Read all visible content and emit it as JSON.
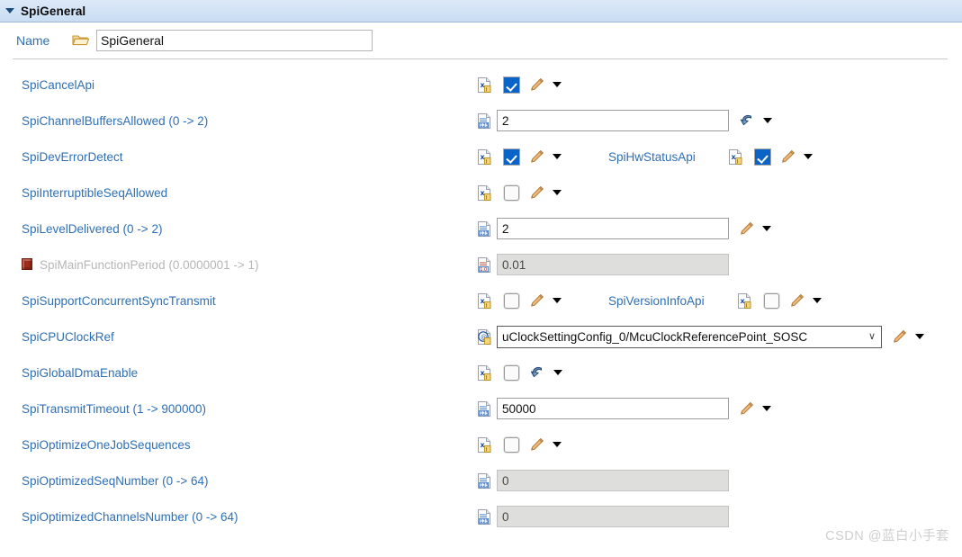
{
  "section": {
    "title": "SpiGeneral",
    "twisty_icon": "chevron-down-icon"
  },
  "name_row": {
    "label": "Name",
    "folder_icon": "folder-open-icon",
    "value": "SpiGeneral",
    "placeholder": ""
  },
  "rows": [
    {
      "label": "SpiCancelApi",
      "control": "checkbox",
      "checked": true,
      "value": "",
      "lead_icon": "x-document-icon",
      "trail_icon": "pencil-icon",
      "caret": true,
      "disabled": false,
      "error": false,
      "second": null
    },
    {
      "label": "SpiChannelBuffersAllowed (0 -> 2)",
      "control": "text",
      "checked": false,
      "value": "2",
      "lead_icon": "number-document-icon",
      "trail_icon": "swirl-arrow-icon",
      "caret": true,
      "disabled": false,
      "error": false,
      "second": null
    },
    {
      "label": "SpiDevErrorDetect",
      "control": "checkbox",
      "checked": true,
      "value": "",
      "lead_icon": "x-document-icon",
      "trail_icon": "pencil-icon",
      "caret": true,
      "disabled": false,
      "error": false,
      "second": {
        "label": "SpiHwStatusApi",
        "control": "checkbox",
        "checked": true,
        "lead_icon": "x-document-icon",
        "trail_icon": "pencil-icon",
        "caret": true
      }
    },
    {
      "label": "SpiInterruptibleSeqAllowed",
      "control": "checkbox",
      "checked": false,
      "value": "",
      "lead_icon": "x-document-icon",
      "trail_icon": "pencil-icon",
      "caret": true,
      "disabled": false,
      "error": false,
      "second": null
    },
    {
      "label": "SpiLevelDelivered (0 -> 2)",
      "control": "text",
      "checked": false,
      "value": "2",
      "lead_icon": "number-document-icon",
      "trail_icon": "pencil-icon",
      "caret": true,
      "disabled": false,
      "error": false,
      "second": null
    },
    {
      "label": "SpiMainFunctionPeriod (0.0000001 -> 1)",
      "control": "text-readonly",
      "checked": false,
      "value": "0.01",
      "lead_icon": "float-document-icon",
      "trail_icon": "none",
      "caret": false,
      "disabled": true,
      "error": true,
      "second": null
    },
    {
      "label": "SpiSupportConcurrentSyncTransmit",
      "control": "checkbox",
      "checked": false,
      "value": "",
      "lead_icon": "x-document-icon",
      "trail_icon": "pencil-icon",
      "caret": true,
      "disabled": false,
      "error": false,
      "second": {
        "label": "SpiVersionInfoApi",
        "control": "checkbox",
        "checked": false,
        "lead_icon": "x-document-icon",
        "trail_icon": "pencil-icon",
        "caret": true
      }
    },
    {
      "label": "SpiCPUClockRef",
      "control": "combo",
      "checked": false,
      "value": "uClockSettingConfig_0/McuClockReferencePoint_SOSC",
      "lead_icon": "at-document-icon",
      "trail_icon": "pencil-icon",
      "caret": true,
      "disabled": false,
      "error": false,
      "second": null
    },
    {
      "label": "SpiGlobalDmaEnable",
      "control": "checkbox",
      "checked": false,
      "value": "",
      "lead_icon": "x-document-icon",
      "trail_icon": "swirl-arrow-icon",
      "caret": true,
      "disabled": false,
      "error": false,
      "second": null
    },
    {
      "label": "SpiTransmitTimeout (1 -> 900000)",
      "control": "text",
      "checked": false,
      "value": "50000",
      "lead_icon": "number-document-icon",
      "trail_icon": "pencil-icon",
      "caret": true,
      "disabled": false,
      "error": false,
      "second": null
    },
    {
      "label": "SpiOptimizeOneJobSequences",
      "control": "checkbox",
      "checked": false,
      "value": "",
      "lead_icon": "x-document-icon",
      "trail_icon": "pencil-icon",
      "caret": true,
      "disabled": false,
      "error": false,
      "second": null
    },
    {
      "label": "SpiOptimizedSeqNumber (0 -> 64)",
      "control": "text-readonly",
      "checked": false,
      "value": "0",
      "lead_icon": "number-document-icon",
      "trail_icon": "none",
      "caret": false,
      "disabled": false,
      "error": false,
      "second": null
    },
    {
      "label": "SpiOptimizedChannelsNumber (0 -> 64)",
      "control": "text-readonly",
      "checked": false,
      "value": "0",
      "lead_icon": "number-document-icon",
      "trail_icon": "none",
      "caret": false,
      "disabled": false,
      "error": false,
      "second": null
    }
  ],
  "watermark": "CSDN @蓝白小手套",
  "colors": {
    "link": "#2f6fb5",
    "header_bg": "#d2e3f5",
    "checkbox_checked": "#0a64c8",
    "readonly_bg": "#dededd",
    "error_marker": "#9e2b17"
  }
}
